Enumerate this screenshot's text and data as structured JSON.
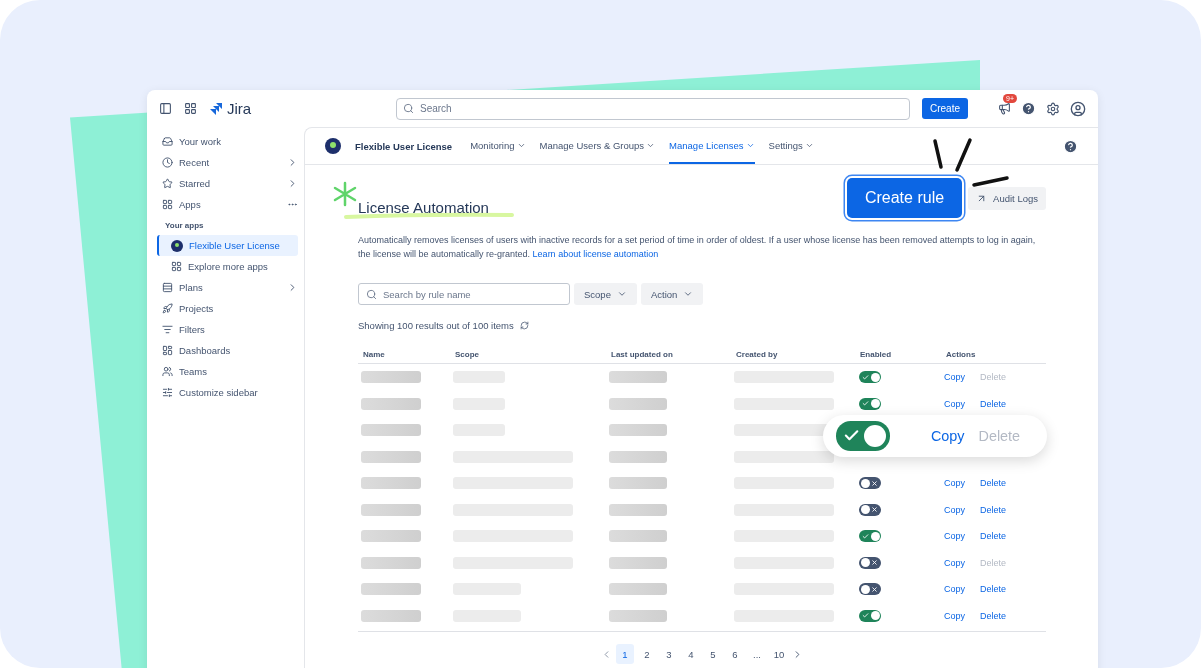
{
  "topbar": {
    "logo_text": "Jira",
    "search": {
      "placeholder": "Search"
    },
    "create_button": "Create",
    "notification_badge": "9+"
  },
  "sidebar": {
    "items": [
      {
        "label": "Your work",
        "chevron": false,
        "selected": false,
        "kind": "item"
      },
      {
        "label": "Recent",
        "chevron": true,
        "selected": false,
        "kind": "item"
      },
      {
        "label": "Starred",
        "chevron": true,
        "selected": false,
        "kind": "item"
      },
      {
        "label": "Apps",
        "chevron": false,
        "more": true,
        "selected": false,
        "kind": "item"
      },
      {
        "label": "Your apps",
        "kind": "heading"
      },
      {
        "label": "Flexible User License",
        "chevron": false,
        "selected": true,
        "kind": "subitem"
      },
      {
        "label": "Explore more apps",
        "chevron": false,
        "selected": false,
        "kind": "subitem"
      },
      {
        "label": "Plans",
        "chevron": true,
        "selected": false,
        "kind": "item"
      },
      {
        "label": "Projects",
        "chevron": false,
        "selected": false,
        "kind": "item"
      },
      {
        "label": "Filters",
        "chevron": false,
        "selected": false,
        "kind": "item"
      },
      {
        "label": "Dashboards",
        "chevron": false,
        "selected": false,
        "kind": "item"
      },
      {
        "label": "Teams",
        "chevron": false,
        "selected": false,
        "kind": "item"
      },
      {
        "label": "Customize sidebar",
        "chevron": false,
        "selected": false,
        "kind": "item"
      }
    ]
  },
  "app_nav": {
    "app_name": "Flexible User License",
    "tabs": [
      {
        "label": "Monitoring",
        "selected": false
      },
      {
        "label": "Manage Users & Groups",
        "selected": false
      },
      {
        "label": "Manage Licenses",
        "selected": true
      },
      {
        "label": "Settings",
        "selected": false
      }
    ]
  },
  "page": {
    "title": "License Automation",
    "create_rule_button": "Create rule",
    "audit_logs_button": "Audit Logs",
    "description": "Automatically removes licenses of users with inactive records for a set period of time in order of oldest. If a user whose license has been removed attempts to log in again, the license will be automatically re-granted.",
    "description_link": "Learn about license automation",
    "search": {
      "placeholder": "Search by rule name"
    },
    "filters": [
      "Scope",
      "Action"
    ],
    "results_text": "Showing 100 results out of 100 items"
  },
  "table": {
    "columns": [
      "Name",
      "Scope",
      "Last updated on",
      "Created by",
      "Enabled",
      "Actions"
    ],
    "rows": [
      {
        "kind": "row",
        "enabled": true,
        "copy": "Copy",
        "delete": "Delete",
        "delete_disabled": true
      },
      {
        "kind": "row",
        "enabled": true,
        "copy": "Copy",
        "delete": "Delete",
        "delete_disabled": false
      },
      {
        "kind": "covered"
      },
      {
        "kind": "covered"
      },
      {
        "kind": "row",
        "enabled": false,
        "copy": "Copy",
        "delete": "Delete",
        "delete_disabled": false
      },
      {
        "kind": "row",
        "enabled": false,
        "copy": "Copy",
        "delete": "Delete",
        "delete_disabled": false
      },
      {
        "kind": "row",
        "enabled": true,
        "copy": "Copy",
        "delete": "Delete",
        "delete_disabled": false
      },
      {
        "kind": "row",
        "enabled": false,
        "copy": "Copy",
        "delete": "Delete",
        "delete_disabled": true
      },
      {
        "kind": "row",
        "enabled": false,
        "copy": "Copy",
        "delete": "Delete",
        "delete_disabled": false
      },
      {
        "kind": "row",
        "enabled": true,
        "copy": "Copy",
        "delete": "Delete",
        "delete_disabled": false
      }
    ]
  },
  "callout": {
    "enabled": true,
    "copy": "Copy",
    "delete": "Delete",
    "delete_disabled": true
  },
  "pagination": {
    "pages": [
      {
        "label": "1",
        "selected": true
      },
      {
        "label": "2",
        "selected": false
      },
      {
        "label": "3",
        "selected": false
      },
      {
        "label": "4",
        "selected": false
      },
      {
        "label": "5",
        "selected": false
      },
      {
        "label": "6",
        "selected": false
      },
      {
        "label": "...",
        "selected": false
      },
      {
        "label": "10",
        "selected": false
      }
    ]
  }
}
